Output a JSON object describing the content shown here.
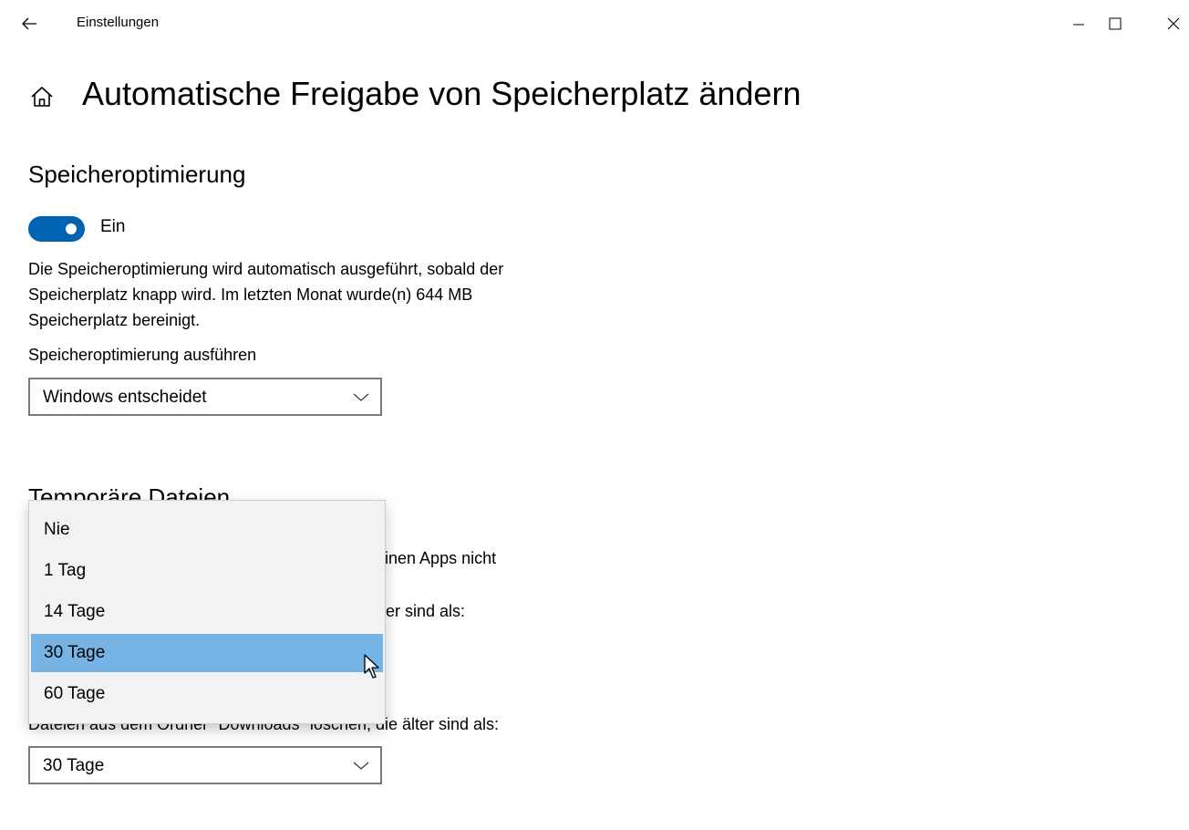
{
  "window": {
    "title": "Einstellungen",
    "back_icon": "arrow-left-icon",
    "minimize_icon": "minimize-icon",
    "maximize_icon": "maximize-icon",
    "close_icon": "close-icon"
  },
  "header": {
    "home_icon": "home-icon",
    "title": "Automatische Freigabe von Speicherplatz ändern"
  },
  "storage_sense": {
    "heading": "Speicheroptimierung",
    "toggle_state": "Ein",
    "toggle_on": true,
    "accent_color": "#0063b1",
    "description_lines": [
      "Die Speicheroptimierung wird automatisch ausgeführt, sobald der",
      "Speicherplatz knapp wird. Im letzten Monat wurde(n) 644 MB",
      "Speicherplatz bereinigt."
    ],
    "run_label": "Speicheroptimierung ausführen",
    "run_value": "Windows entscheidet"
  },
  "temp_files": {
    "heading": "Temporäre Dateien",
    "partial_line_1": "einen Apps nicht",
    "partial_line_2": "lter sind als:",
    "downloads_label": "Dateien aus dem Ordner \"Downloads\" löschen, die älter sind als:",
    "downloads_value": "30 Tage"
  },
  "dropdown": {
    "options": [
      "Nie",
      "1 Tag",
      "14 Tage",
      "30 Tage",
      "60 Tage"
    ],
    "selected_index": 3,
    "highlight_color": "#77b4e6"
  }
}
